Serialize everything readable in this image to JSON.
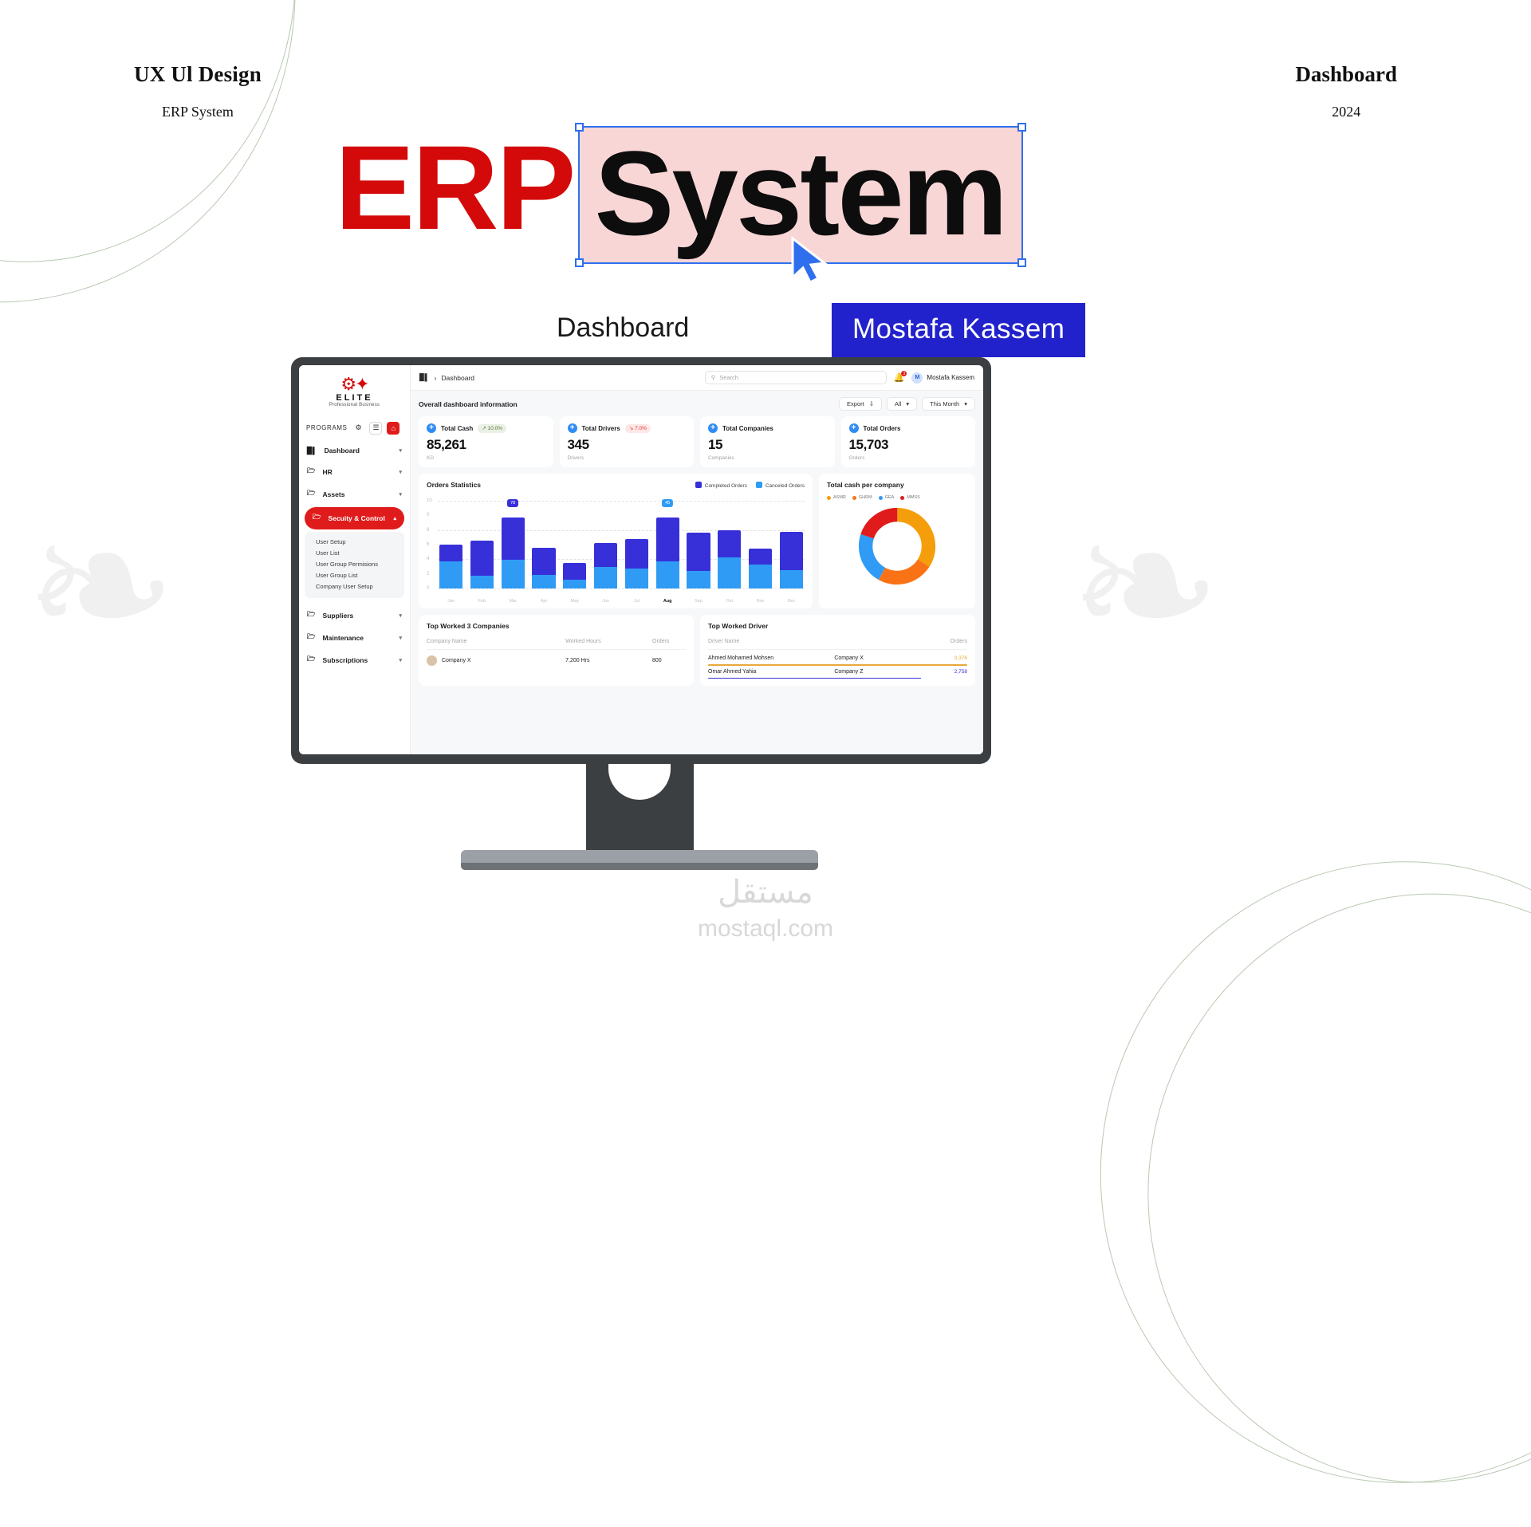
{
  "poster": {
    "left_title": "UX Ul Design",
    "left_sub": "ERP System",
    "right_title": "Dashboard",
    "right_sub": "2024",
    "logo_red": "ERP",
    "logo_black": "System",
    "caption": "Dashboard",
    "author": "Mostafa Kassem",
    "watermark_ar": "مستقل",
    "watermark_en": "mostaql.com",
    "accent_red": "#d40a0a",
    "accent_blue": "#2222cc"
  },
  "app": {
    "brand": {
      "name": "ELITE",
      "tagline": "Professional Business"
    },
    "sidebar": {
      "section_label": "PROGRAMS",
      "section_icons": [
        "gear-icon",
        "note-icon",
        "home-icon"
      ],
      "items": [
        {
          "label": "Dashboard",
          "icon": "bar-chart-icon",
          "active": false
        },
        {
          "label": "HR",
          "icon": "folder-icon",
          "active": false
        },
        {
          "label": "Assets",
          "icon": "folder-icon",
          "active": false
        },
        {
          "label": "Secuity & Control",
          "icon": "folder-icon",
          "active": true
        },
        {
          "label": "Suppliers",
          "icon": "folder-icon",
          "active": false
        },
        {
          "label": "Maintenance",
          "icon": "folder-icon",
          "active": false
        },
        {
          "label": "Subscriptions",
          "icon": "folder-icon",
          "active": false
        }
      ],
      "submenu": [
        "User Setup",
        "User List",
        "User Group Permisions",
        "User Group List",
        "Company User Setup"
      ]
    },
    "topbar": {
      "breadcrumb": "Dashboard",
      "search_placeholder": "Search",
      "notification_count": "3",
      "user_name": "Mostafa Kassem",
      "user_initial": "M"
    },
    "toolbar": {
      "title": "Overall dashboard information",
      "export_label": "Export",
      "filter_all": "All",
      "filter_period": "This Month"
    },
    "kpis": [
      {
        "label": "Total Cash",
        "value": "85,261",
        "unit": "KD",
        "delta": "10.0%",
        "trend": "up"
      },
      {
        "label": "Total Drivers",
        "value": "345",
        "unit": "Drivers",
        "delta": "7.0%",
        "trend": "down"
      },
      {
        "label": "Total Companies",
        "value": "15",
        "unit": "Companies",
        "delta": "",
        "trend": ""
      },
      {
        "label": "Total Orders",
        "value": "15,703",
        "unit": "Orders",
        "delta": "",
        "trend": ""
      }
    ],
    "tables": {
      "companies": {
        "title": "Top Worked 3 Companies",
        "headers": [
          "Company Name",
          "Worked Hours",
          "Orders"
        ],
        "rows": [
          {
            "name": "Company X",
            "hours": "7,200 Hrs",
            "orders": "800"
          }
        ]
      },
      "drivers": {
        "title": "Top Worked Driver",
        "headers": [
          "Driver Name",
          "",
          "Orders"
        ],
        "rows": [
          {
            "name": "Ahmed Mohamed Mohsen",
            "company": "Company X",
            "orders": "3,376",
            "color": "#e8a93a"
          },
          {
            "name": "Omar Ahmed Yahia",
            "company": "Company Z",
            "orders": "2,758",
            "color": "#3730d8"
          }
        ]
      }
    }
  },
  "chart_data": [
    {
      "type": "bar",
      "title": "Orders Statistics",
      "stacked": true,
      "legend": [
        {
          "name": "Completed Orders",
          "color": "#3730d8"
        },
        {
          "name": "Canceled Orders",
          "color": "#2f9bf5"
        }
      ],
      "legend_position": "top-right",
      "grid": true,
      "categories": [
        "Jan",
        "Feb",
        "Mar",
        "Apr",
        "May",
        "Jun",
        "Jul",
        "Aug",
        "Sep",
        "Oct",
        "Nov",
        "Dec"
      ],
      "highlight_category": "Aug",
      "yticks": [
        "10",
        "0",
        "8",
        "6",
        "4",
        "2",
        "0"
      ],
      "ylim": [
        0,
        100
      ],
      "series": [
        {
          "name": "Canceled Orders",
          "color": "#2f9bf5",
          "values": [
            30,
            14,
            32,
            15,
            10,
            24,
            22,
            30,
            19,
            34,
            26,
            20
          ]
        },
        {
          "name": "Completed Orders",
          "color": "#3730d8",
          "values": [
            18,
            39,
            46,
            30,
            18,
            26,
            32,
            48,
            42,
            30,
            18,
            42
          ]
        }
      ],
      "annotations": [
        {
          "category": "Mar",
          "value": "78",
          "color": "#3730d8"
        },
        {
          "category": "Aug",
          "value": "45",
          "color": "#2f9bf5"
        }
      ]
    },
    {
      "type": "pie",
      "title": "Total cash per company",
      "donut": true,
      "labels": [
        "ASMR",
        "GHRM",
        "GEA",
        "MMSS"
      ],
      "values": [
        34,
        24,
        22,
        20
      ],
      "colors": [
        "#f59e0b",
        "#f97316",
        "#2f9bf5",
        "#e01b1b"
      ],
      "legend_position": "top"
    }
  ]
}
